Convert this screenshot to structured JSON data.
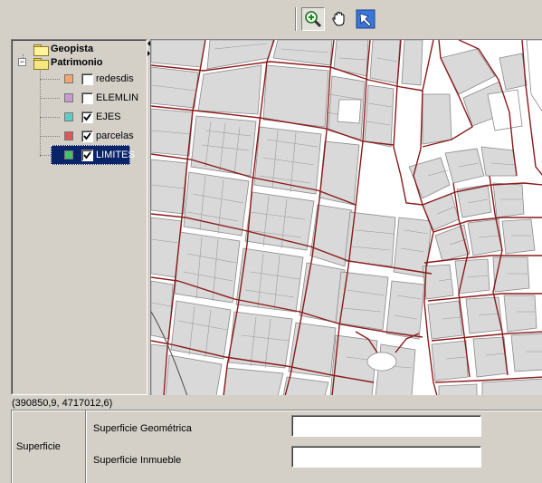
{
  "toolbar": {
    "buttons": [
      {
        "icon": "zoom-in-icon",
        "pressed": true
      },
      {
        "icon": "pan-hand-icon",
        "pressed": false
      },
      {
        "icon": "select-arrow-icon",
        "pressed": false
      }
    ]
  },
  "tree": {
    "root": {
      "label": "Geopista"
    },
    "group": {
      "label": "Patrimonio",
      "expander": "−"
    },
    "layers": [
      {
        "label": "redesdis",
        "checked": false,
        "color": "#f4a66a",
        "selected": false
      },
      {
        "label": "ELEMLIN",
        "checked": false,
        "color": "#c89ad4",
        "selected": false
      },
      {
        "label": "EJES",
        "checked": true,
        "color": "#5ecdc8",
        "selected": false
      },
      {
        "label": "parcelas",
        "checked": true,
        "color": "#d85a5a",
        "selected": false
      },
      {
        "label": "LIMITES",
        "checked": true,
        "color": "#42c26a",
        "selected": true
      }
    ]
  },
  "map": {
    "background": "#ffffff",
    "block_fill": "#d9d9d9",
    "parcel_stroke": "#8a8a8a",
    "street_edge_color": "#8b1a1a"
  },
  "status": {
    "coordinates": "(390850,9, 4717012,6)"
  },
  "properties": {
    "group_label": "Superficie",
    "fields": [
      {
        "label": "Superficie Geométrica",
        "value": ""
      },
      {
        "label": "Superficie Inmueble",
        "value": ""
      }
    ]
  }
}
